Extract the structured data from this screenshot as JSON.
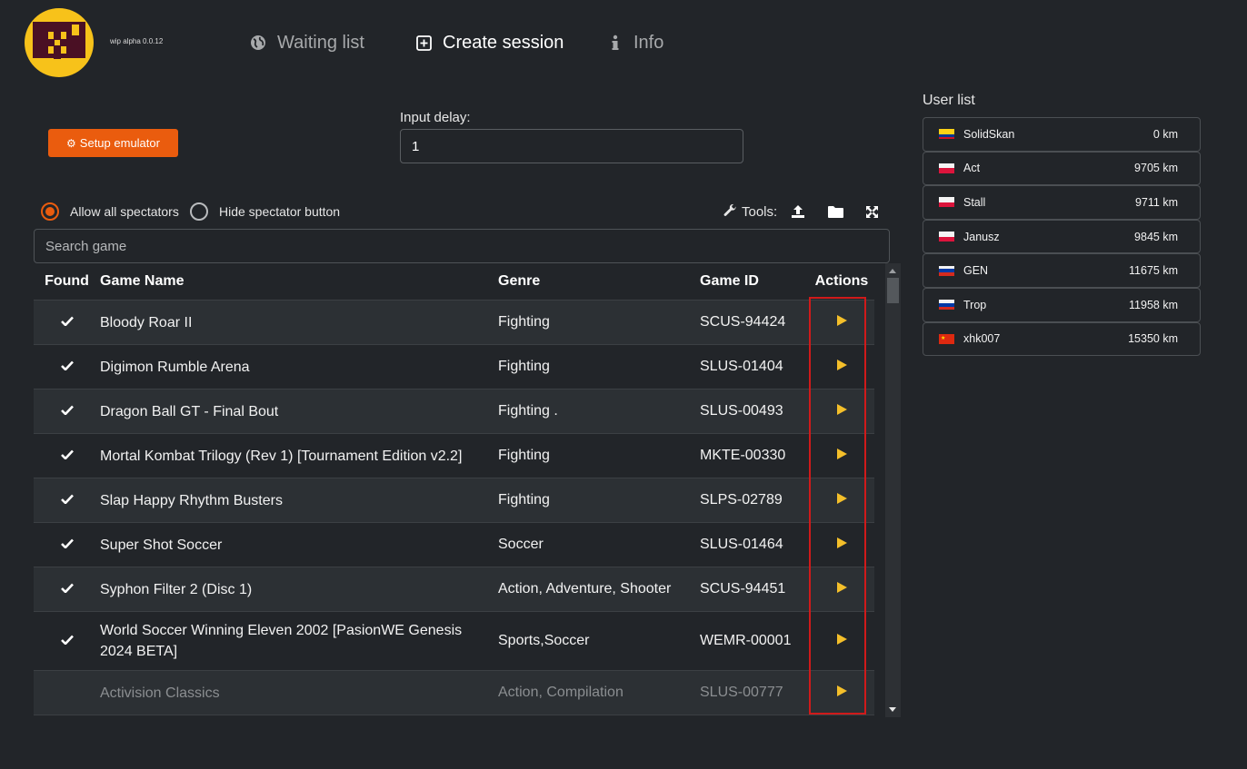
{
  "header": {
    "version": "wip alpha 0.0.12",
    "nav": [
      {
        "label": "Waiting list",
        "icon": "globe-icon",
        "active": false
      },
      {
        "label": "Create session",
        "icon": "plus-square-icon",
        "active": true
      },
      {
        "label": "Info",
        "icon": "info-icon",
        "active": false
      }
    ]
  },
  "setup": {
    "button_label": "Setup emulator",
    "input_delay_label": "Input delay:",
    "input_delay_value": "1"
  },
  "spectators": {
    "allow_all_label": "Allow all spectators",
    "hide_button_label": "Hide spectator button",
    "selected": "allow_all"
  },
  "tools": {
    "label": "Tools:",
    "icons": [
      "upload-icon",
      "folder-icon",
      "expand-icon"
    ]
  },
  "search": {
    "placeholder": "Search game",
    "value": ""
  },
  "table": {
    "headers": {
      "found": "Found",
      "name": "Game Name",
      "genre": "Genre",
      "id": "Game ID",
      "actions": "Actions"
    },
    "rows": [
      {
        "found": true,
        "name": "Bloody Roar II",
        "genre": "Fighting",
        "id": "SCUS-94424"
      },
      {
        "found": true,
        "name": "Digimon Rumble Arena",
        "genre": "Fighting",
        "id": "SLUS-01404"
      },
      {
        "found": true,
        "name": "Dragon Ball GT - Final Bout",
        "genre": "Fighting .",
        "id": "SLUS-00493"
      },
      {
        "found": true,
        "name": "Mortal Kombat Trilogy (Rev 1) [Tournament Edition v2.2]",
        "genre": "Fighting",
        "id": "MKTE-00330"
      },
      {
        "found": true,
        "name": "Slap Happy Rhythm Busters",
        "genre": "Fighting",
        "id": "SLPS-02789"
      },
      {
        "found": true,
        "name": "Super Shot Soccer",
        "genre": "Soccer",
        "id": "SLUS-01464"
      },
      {
        "found": true,
        "name": "Syphon Filter 2 (Disc 1)",
        "genre": "Action, Adventure, Shooter",
        "id": "SCUS-94451"
      },
      {
        "found": true,
        "name": "World Soccer Winning Eleven 2002 [PasionWE Genesis 2024 BETA]",
        "genre": "Sports,Soccer",
        "id": "WEMR-00001"
      },
      {
        "found": false,
        "name": "Activision Classics",
        "genre": "Action, Compilation",
        "id": "SLUS-00777"
      }
    ]
  },
  "user_list": {
    "title": "User list",
    "users": [
      {
        "name": "SolidSkan",
        "distance": "0 km",
        "flag": "colombia"
      },
      {
        "name": "Act",
        "distance": "9705 km",
        "flag": "poland"
      },
      {
        "name": "Stall",
        "distance": "9711 km",
        "flag": "poland"
      },
      {
        "name": "Janusz",
        "distance": "9845 km",
        "flag": "poland"
      },
      {
        "name": "GEN",
        "distance": "11675 km",
        "flag": "russia"
      },
      {
        "name": "Trop",
        "distance": "11958 km",
        "flag": "russia"
      },
      {
        "name": "xhk007",
        "distance": "15350 km",
        "flag": "china"
      }
    ]
  },
  "colors": {
    "background": "#222529",
    "accent": "#ea5c0e",
    "logo": "#f7c21a",
    "play": "#f4bf2a",
    "highlight": "#d01a1a"
  }
}
